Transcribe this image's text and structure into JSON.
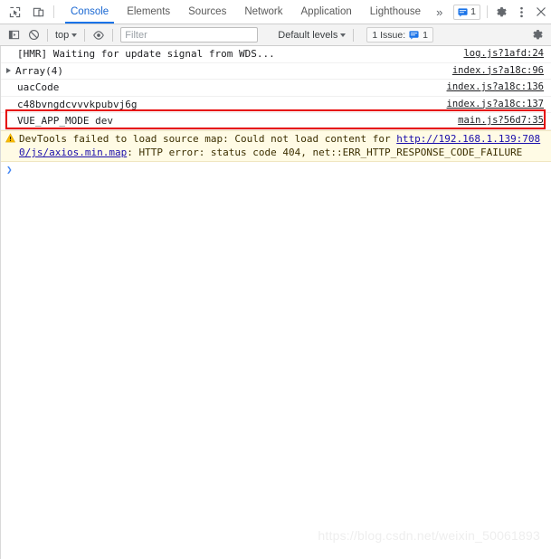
{
  "tabbar": {
    "icons": [
      {
        "name": "inspect-element-icon",
        "title": "Inspect"
      },
      {
        "name": "device-toolbar-icon",
        "title": "Toggle device toolbar"
      }
    ],
    "tabs": [
      {
        "label": "Console",
        "active": true
      },
      {
        "label": "Elements",
        "active": false
      },
      {
        "label": "Sources",
        "active": false
      },
      {
        "label": "Network",
        "active": false
      },
      {
        "label": "Application",
        "active": false
      },
      {
        "label": "Lighthouse",
        "active": false
      }
    ],
    "more_label": "»",
    "issue_count": "1",
    "settings_label": "⚙",
    "more_options_label": "⋮",
    "close_label": "✕"
  },
  "filterbar": {
    "sidebar_toggle_name": "console-sidebar-icon",
    "clear_console_name": "clear-console-icon",
    "context_value": "top",
    "eye_icon_name": "live-expression-icon",
    "filter_placeholder": "Filter",
    "filter_value": "",
    "levels_value": "Default levels",
    "issues_label": "1 Issue:",
    "issues_count": "1",
    "settings_name": "console-settings-icon"
  },
  "console": {
    "messages": [
      {
        "text": "[HMR] Waiting for update signal from WDS...",
        "source": "log.js?1afd:24",
        "type": "log",
        "expandable": false,
        "highlighted": false
      },
      {
        "text": "Array(4)",
        "source": "index.js?a18c:96",
        "type": "log",
        "expandable": true,
        "highlighted": false
      },
      {
        "text": "uacCode",
        "source": "index.js?a18c:136",
        "type": "log",
        "expandable": false,
        "highlighted": false
      },
      {
        "text": "c48bvngdcvvvkpubvj6g",
        "source": "index.js?a18c:137",
        "type": "log",
        "expandable": false,
        "highlighted": false
      },
      {
        "text": "VUE_APP_MODE dev",
        "source": "main.js?56d7:35",
        "type": "log",
        "expandable": false,
        "highlighted": true
      }
    ],
    "warning": {
      "text_before": "DevTools failed to load source map: Could not load content for ",
      "link": "http://192.168.1.139:7080/js/axios.min.map",
      "text_after": ": HTTP error: status code 404, net::ERR_HTTP_RESPONSE_CODE_FAILURE",
      "icon_name": "warning-triangle-icon"
    },
    "prompt_symbol": "❯"
  },
  "watermark": "https://blog.csdn.net/weixin_50061893",
  "colors": {
    "accent_blue": "#1a73e8",
    "highlight_red": "#e60000",
    "warning_bg": "#fffbe5",
    "link_blue": "#1a0dab"
  }
}
